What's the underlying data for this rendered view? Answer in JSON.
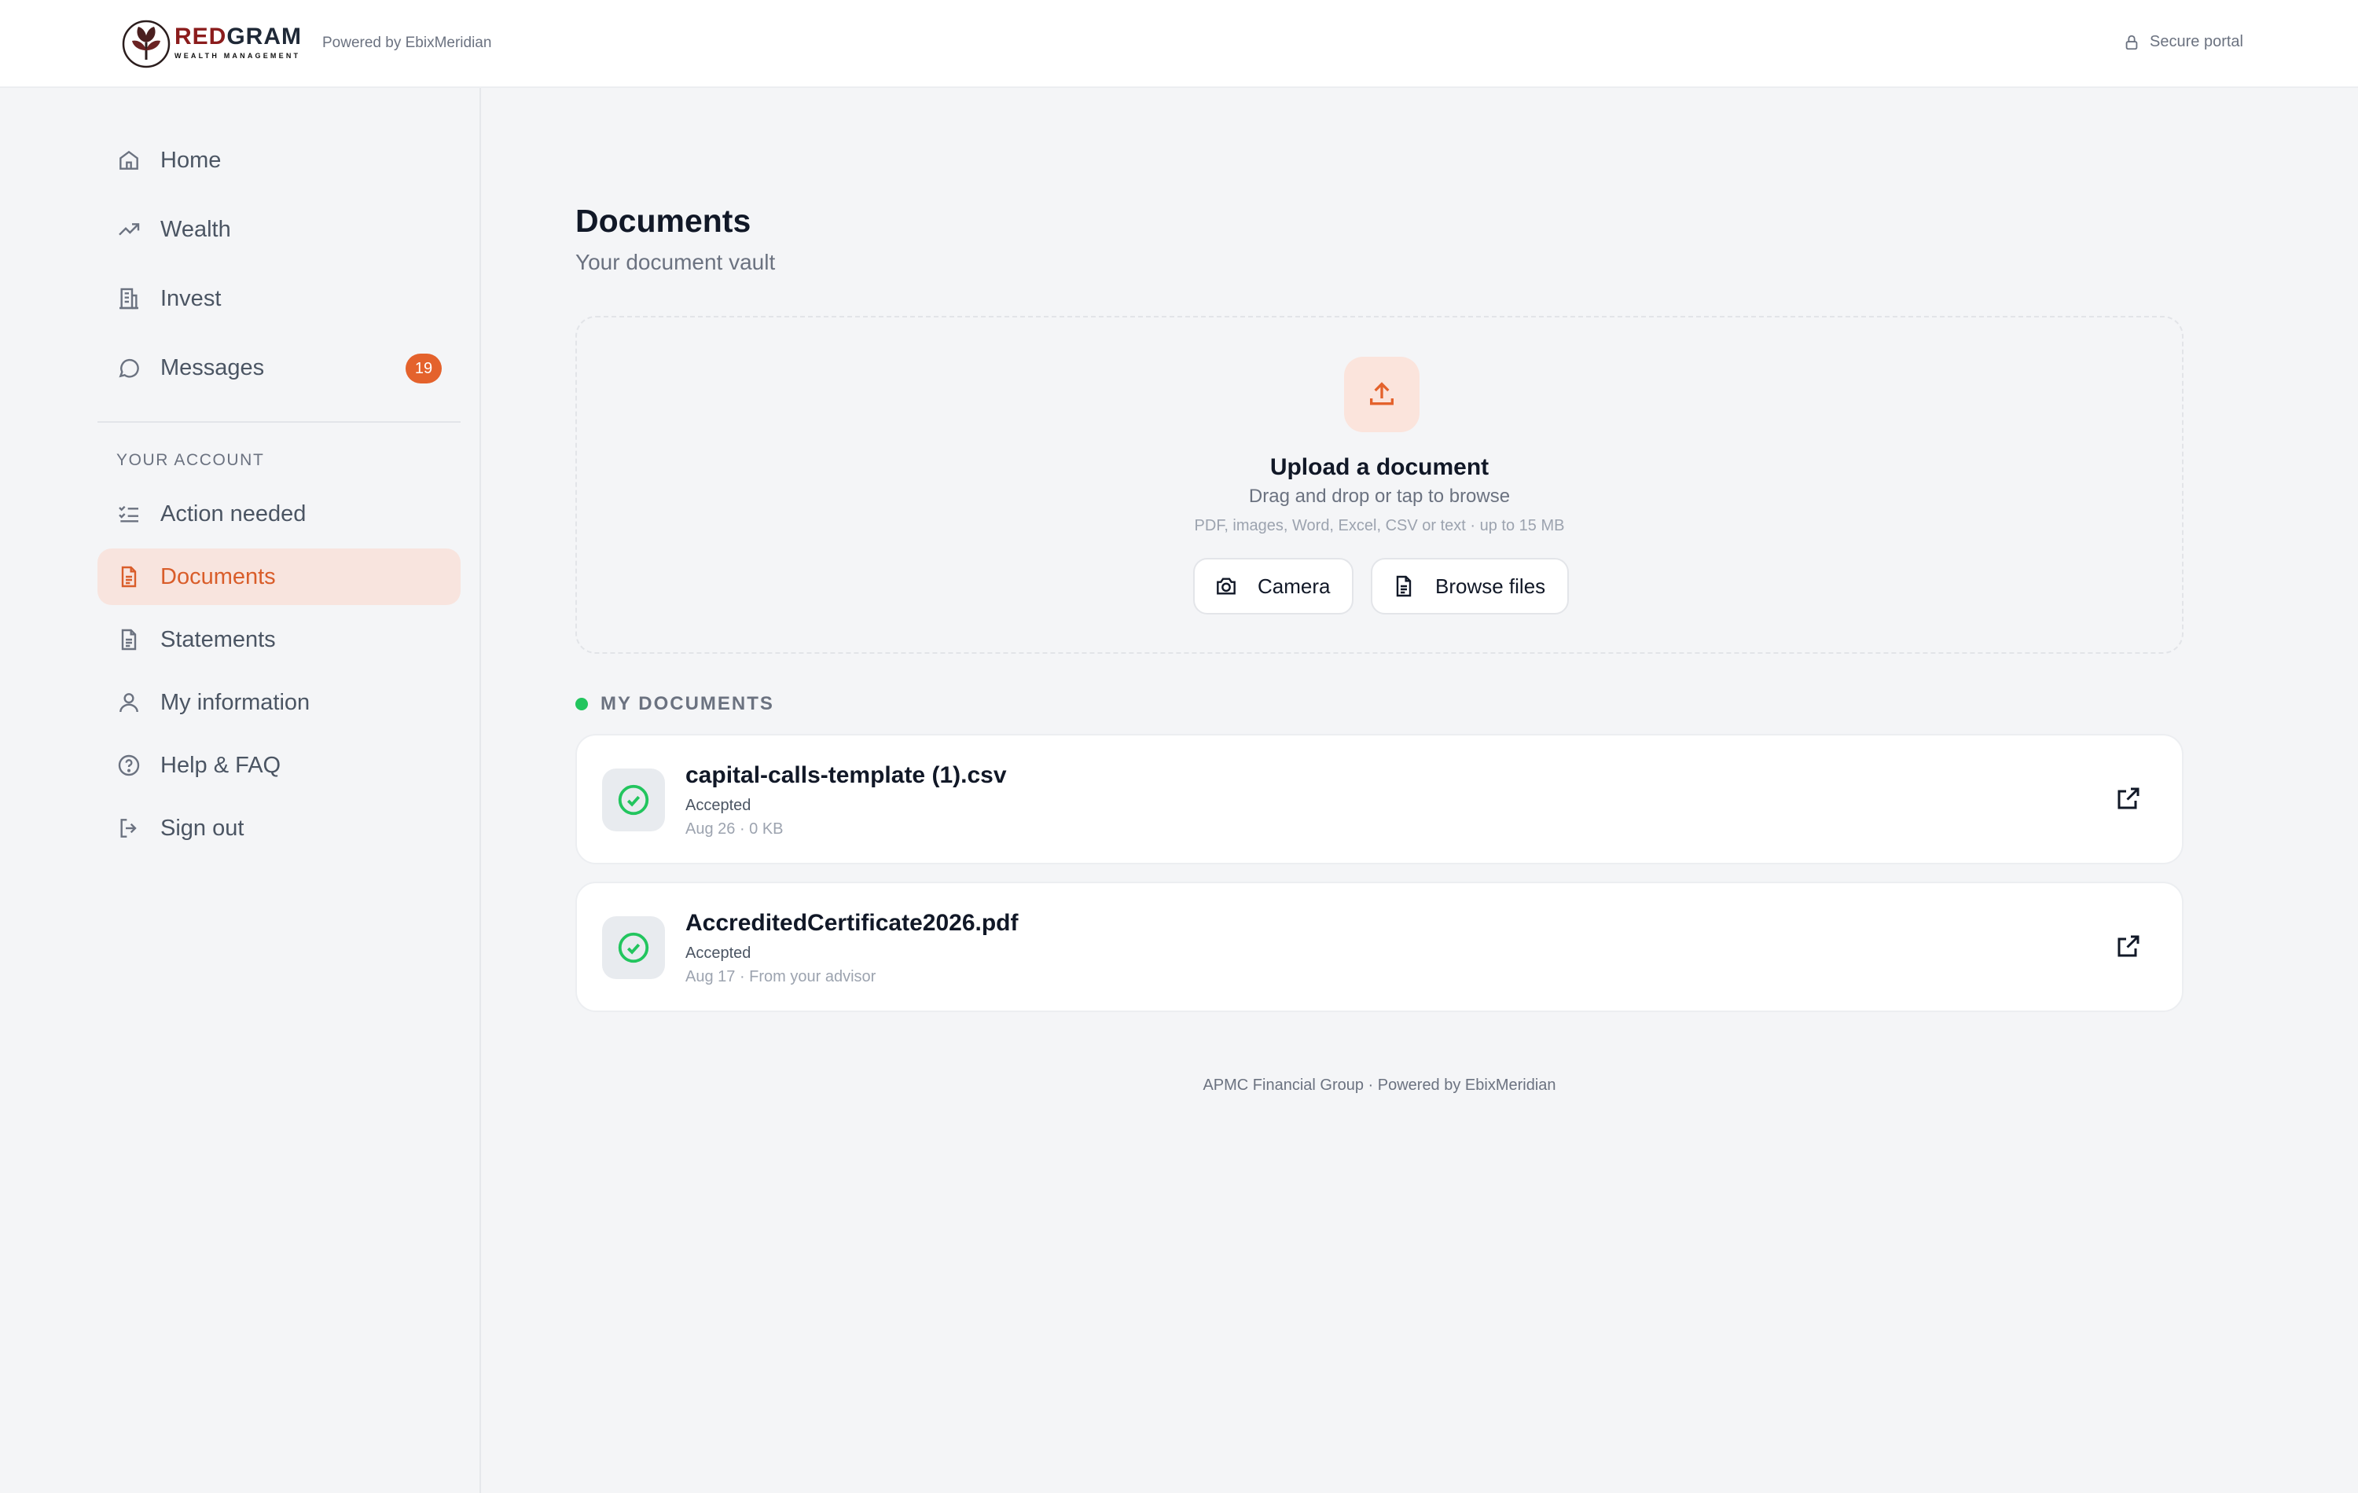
{
  "header": {
    "brand_name_a": "RED",
    "brand_name_b": "GRAM",
    "brand_tagline": "WEALTH MANAGEMENT",
    "powered_by": "Powered by EbixMeridian",
    "secure_label": "Secure portal"
  },
  "sidebar": {
    "items": [
      {
        "label": "Home",
        "icon": "home-icon"
      },
      {
        "label": "Wealth",
        "icon": "trending-up-icon"
      },
      {
        "label": "Invest",
        "icon": "building-icon"
      },
      {
        "label": "Messages",
        "icon": "message-icon",
        "badge": "19"
      }
    ],
    "section_label": "YOUR ACCOUNT",
    "account_items": [
      {
        "label": "Action needed",
        "icon": "list-check-icon"
      },
      {
        "label": "Documents",
        "icon": "document-icon",
        "active": true
      },
      {
        "label": "Statements",
        "icon": "document-icon"
      },
      {
        "label": "My information",
        "icon": "user-icon"
      },
      {
        "label": "Help & FAQ",
        "icon": "help-icon"
      },
      {
        "label": "Sign out",
        "icon": "sign-out-icon"
      }
    ]
  },
  "main": {
    "title": "Documents",
    "subtitle": "Your document vault",
    "upload": {
      "title": "Upload a document",
      "subtitle": "Drag and drop or tap to browse",
      "hint": "PDF, images, Word, Excel, CSV or text · up to 15 MB",
      "camera_label": "Camera",
      "browse_label": "Browse files"
    },
    "docs_label": "MY DOCUMENTS",
    "documents": [
      {
        "name": "capital-calls-template (1).csv",
        "status": "Accepted",
        "meta": "Aug 26 · 0 KB"
      },
      {
        "name": "AccreditedCertificate2026.pdf",
        "status": "Accepted",
        "meta": "Aug 17 · From your advisor"
      }
    ]
  },
  "footer": "APMC Financial Group · Powered by EbixMeridian",
  "colors": {
    "accent": "#e4622c",
    "active_bg": "#f8e4de",
    "success": "#22c55e",
    "brand_red": "#8b1c1c"
  }
}
